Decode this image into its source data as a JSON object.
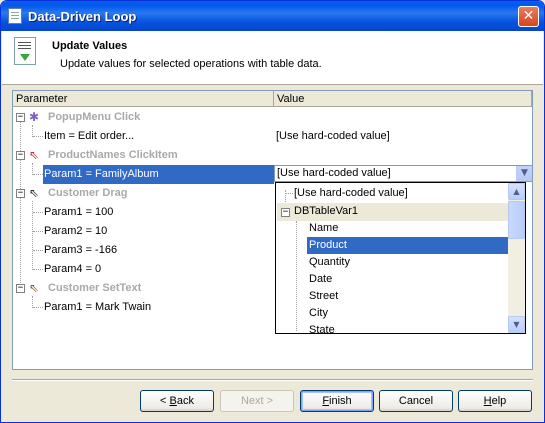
{
  "window": {
    "title": "Data-Driven Loop",
    "close_glyph": "✕"
  },
  "header": {
    "title": "Update Values",
    "subtitle": "Update values for selected operations with table data."
  },
  "grid": {
    "columns": [
      "Parameter",
      "Value"
    ],
    "groups": [
      {
        "label": "PopupMenu Click",
        "icon": "popup-menu-icon",
        "params": [
          {
            "name": "Item = Edit order...",
            "value": "[Use hard-coded value]"
          }
        ]
      },
      {
        "label": "ProductNames ClickItem",
        "icon": "click-cursor-icon",
        "params": [
          {
            "name": "Param1 = FamilyAlbum",
            "value": "[Use hard-coded value]",
            "selected": true
          }
        ]
      },
      {
        "label": "Customer Drag",
        "icon": "drag-cursor-icon",
        "params": [
          {
            "name": "Param1 = 100",
            "value": ""
          },
          {
            "name": "Param2 = 10",
            "value": ""
          },
          {
            "name": "Param3 = -166",
            "value": ""
          },
          {
            "name": "Param4 = 0",
            "value": ""
          }
        ]
      },
      {
        "label": "Customer SetText",
        "icon": "settext-icon",
        "params": [
          {
            "name": "Param1 = Mark Twain",
            "value": ""
          }
        ]
      }
    ]
  },
  "combo": {
    "value": "[Use hard-coded value]"
  },
  "dropdown": {
    "top_item": "[Use hard-coded value]",
    "group": "DBTableVar1",
    "items": [
      "Name",
      "Product",
      "Quantity",
      "Date",
      "Street",
      "City",
      "State"
    ],
    "selected": "Product"
  },
  "buttons": {
    "back": {
      "pre": "< ",
      "accel": "B",
      "post": "ack"
    },
    "next": {
      "label": "Next >"
    },
    "finish": {
      "accel": "F",
      "post": "inish"
    },
    "cancel": {
      "label": "Cancel"
    },
    "help": {
      "accel": "H",
      "post": "elp"
    }
  },
  "colors": {
    "selection": "#316ac5",
    "title_bar": "#0058ee",
    "category_text": "#a9a9a9"
  }
}
